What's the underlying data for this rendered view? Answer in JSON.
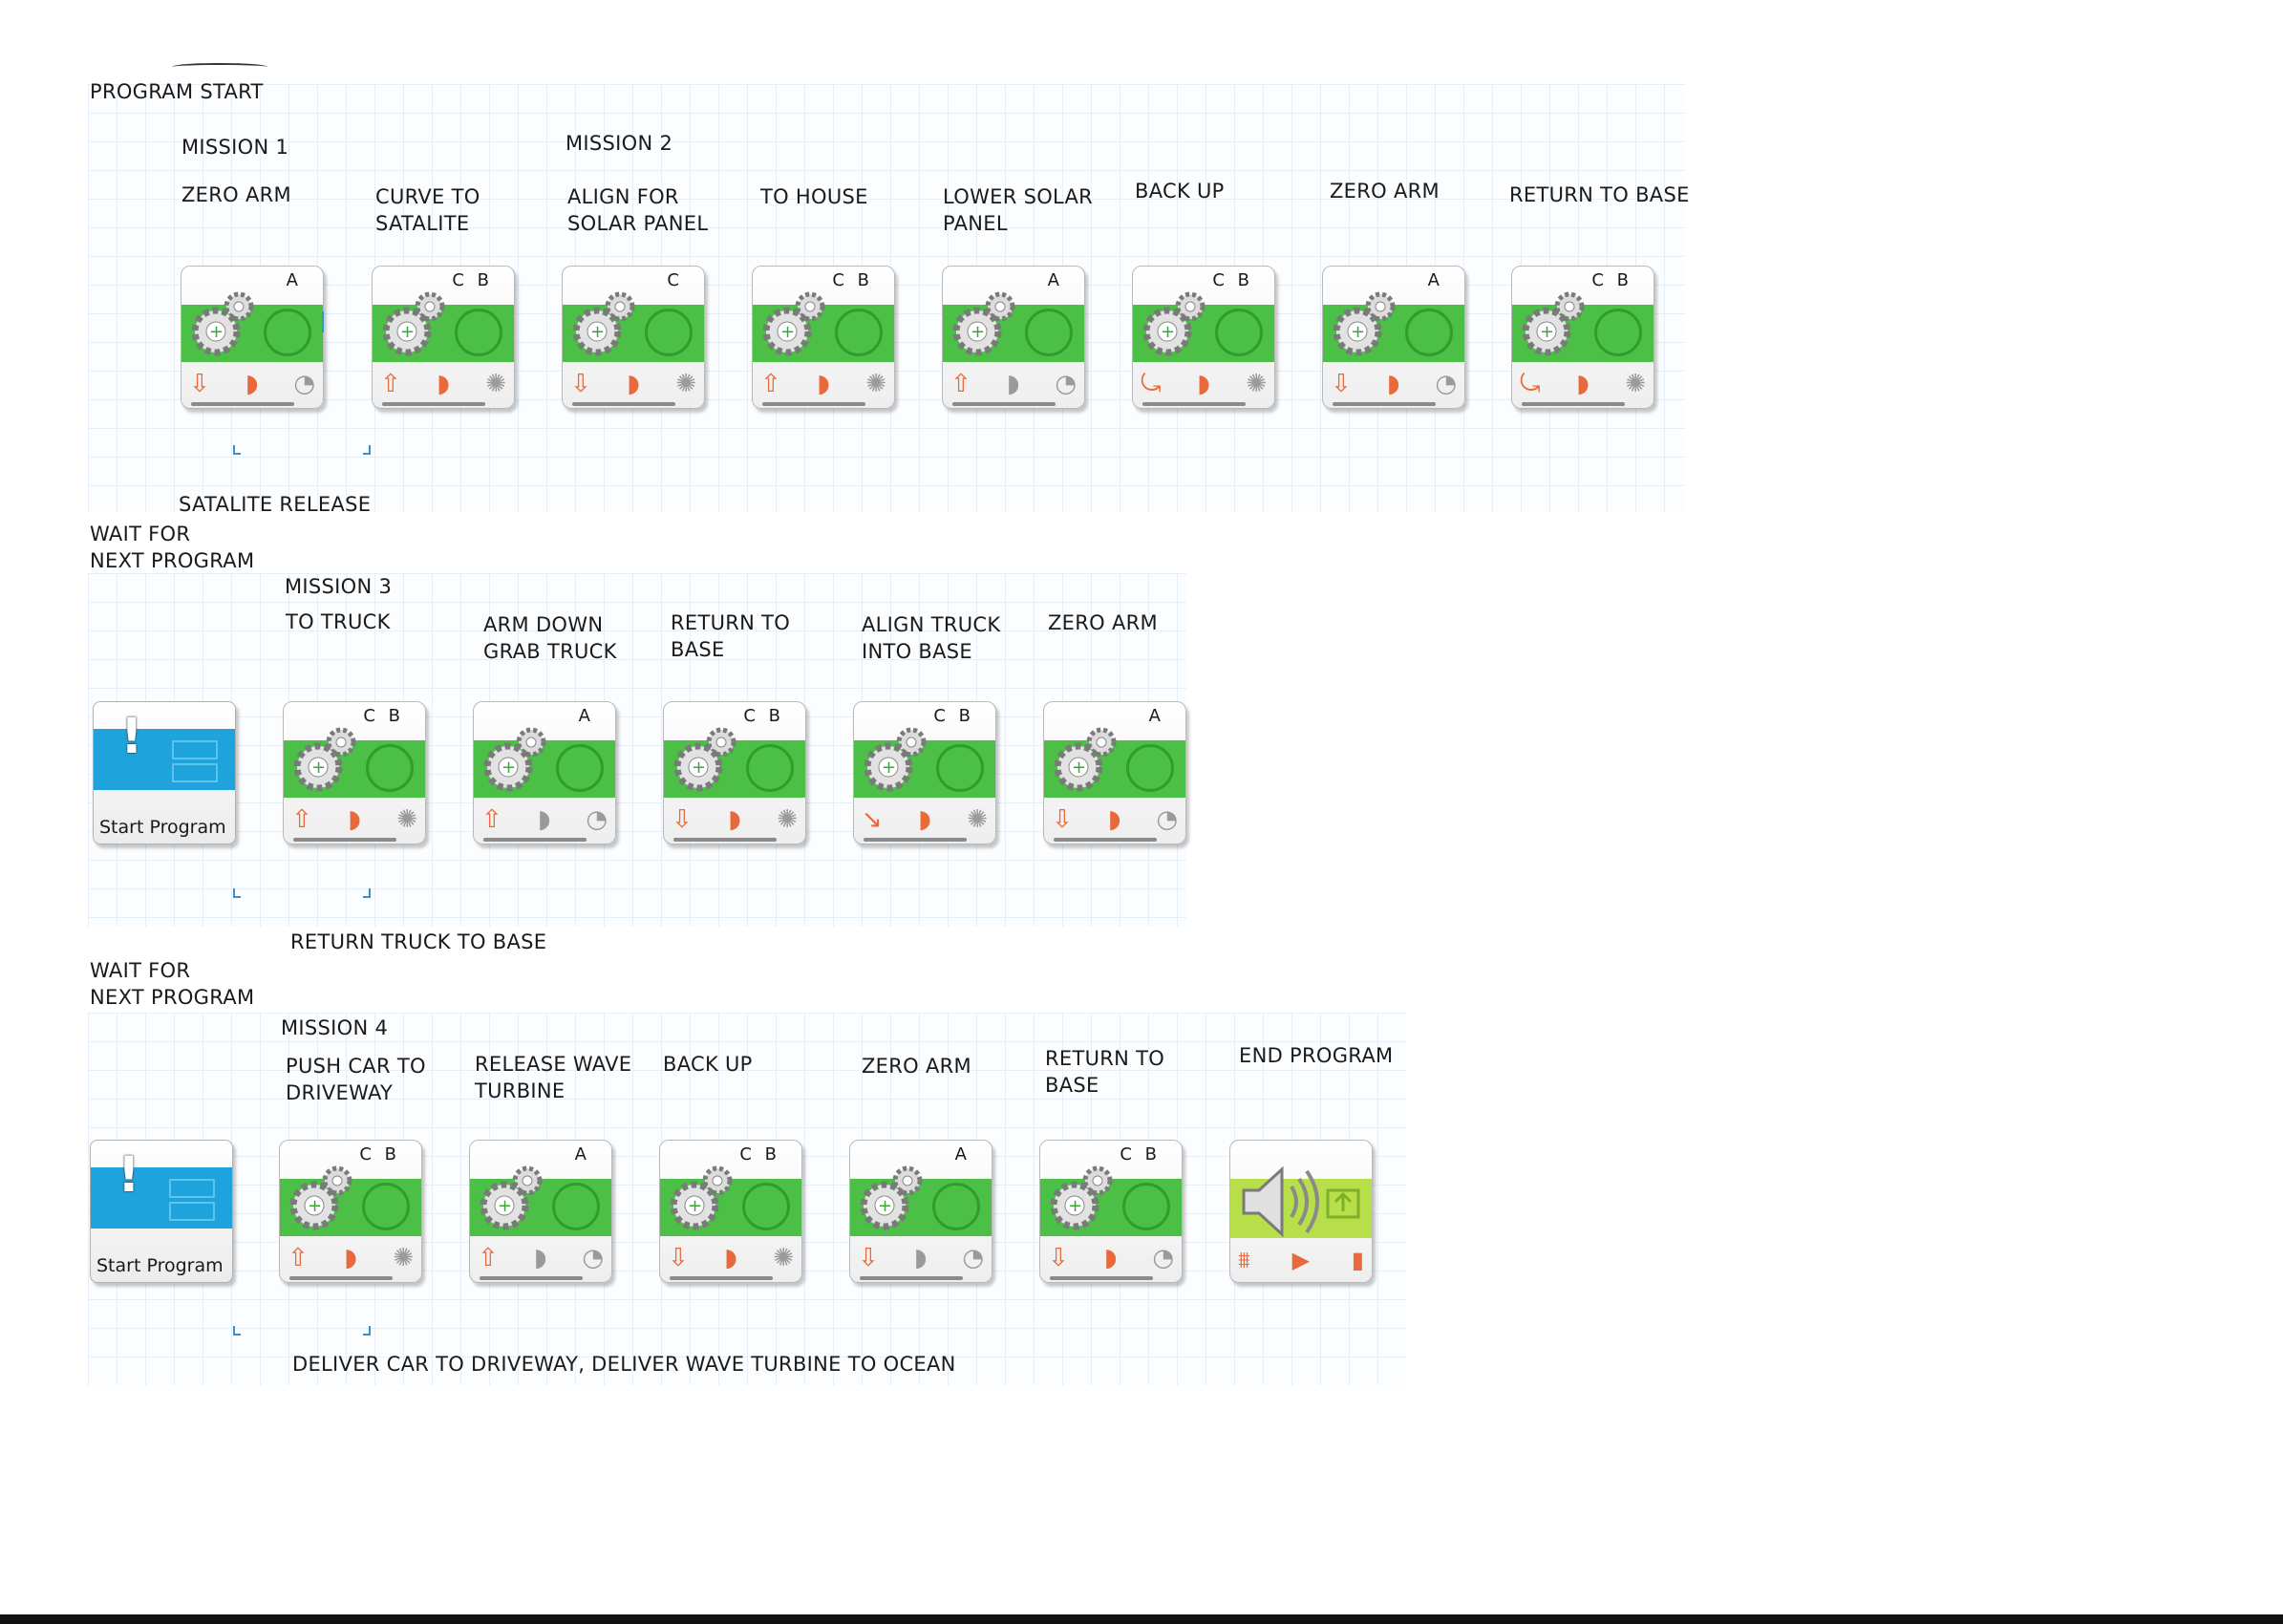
{
  "header": {
    "program_start": "PROGRAM START"
  },
  "row1": {
    "mission1": "MISSION 1",
    "mission2": "MISSION 2",
    "steps": [
      {
        "label": "ZERO ARM",
        "port": "A",
        "dir": "down",
        "power_color": "orange",
        "end": "seconds"
      },
      {
        "label": "CURVE TO\nSATALITE",
        "port": "C B",
        "dir": "up",
        "power_color": "orange",
        "end": "degrees"
      },
      {
        "label": "ALIGN FOR\nSOLAR PANEL",
        "port": "C",
        "dir": "down",
        "power_color": "orange",
        "end": "degrees"
      },
      {
        "label": "TO HOUSE",
        "port": "C B",
        "dir": "up",
        "power_color": "orange",
        "end": "degrees"
      },
      {
        "label": "LOWER SOLAR\nPANEL",
        "port": "A",
        "dir": "up",
        "power_color": "gray",
        "end": "seconds"
      },
      {
        "label": "BACK UP",
        "port": "C B",
        "dir": "steer",
        "power_color": "orange",
        "end": "degrees"
      },
      {
        "label": "ZERO ARM",
        "port": "A",
        "dir": "down",
        "power_color": "orange",
        "end": "seconds"
      },
      {
        "label": "RETURN TO BASE",
        "port": "C B",
        "dir": "steer",
        "power_color": "orange",
        "end": "degrees"
      }
    ],
    "caption": "SATALITE RELEASE"
  },
  "row2": {
    "wait_label": "WAIT FOR\nNEXT PROGRAM",
    "mission": "MISSION 3",
    "start_block_text": "Start Program",
    "steps": [
      {
        "label": "TO TRUCK",
        "port": "C B",
        "dir": "up",
        "power_color": "orange",
        "end": "degrees"
      },
      {
        "label": "ARM DOWN\nGRAB TRUCK",
        "port": "A",
        "dir": "up",
        "power_color": "gray",
        "end": "seconds"
      },
      {
        "label": "RETURN TO\nBASE",
        "port": "C B",
        "dir": "down",
        "power_color": "orange",
        "end": "degrees"
      },
      {
        "label": "ALIGN TRUCK\nINTO BASE",
        "port": "C B",
        "dir": "steer",
        "power_color": "orange",
        "end": "degrees"
      },
      {
        "label": "ZERO ARM",
        "port": "A",
        "dir": "down",
        "power_color": "orange",
        "end": "seconds"
      }
    ],
    "caption": "RETURN TRUCK TO BASE"
  },
  "row3": {
    "wait_label": "WAIT FOR\nNEXT PROGRAM",
    "mission": "MISSION 4",
    "start_block_text": "Start Program",
    "steps": [
      {
        "label": "PUSH CAR TO\nDRIVEWAY",
        "port": "C B",
        "dir": "up",
        "power_color": "orange",
        "end": "degrees"
      },
      {
        "label": "RELEASE WAVE\nTURBINE",
        "port": "A",
        "dir": "up",
        "power_color": "gray",
        "end": "seconds"
      },
      {
        "label": "BACK UP",
        "port": "C B",
        "dir": "down",
        "power_color": "orange",
        "end": "degrees"
      },
      {
        "label": "ZERO ARM",
        "port": "A",
        "dir": "down",
        "power_color": "gray",
        "end": "seconds"
      },
      {
        "label": "RETURN TO\nBASE",
        "port": "C B",
        "dir": "down",
        "power_color": "orange",
        "end": "seconds"
      }
    ],
    "end_label": "END PROGRAM",
    "caption": "DELIVER CAR TO DRIVEWAY, DELIVER WAVE TURBINE TO OCEAN"
  },
  "colors": {
    "motor_band": "#4cc046",
    "start_band": "#1fa3dc",
    "sound_band": "#b7df4a",
    "icon_accent": "#e8693a",
    "connector": "#3a8fd1"
  },
  "icons": {
    "motor": "gears-icon",
    "direction": "arrow-icon",
    "power": "power-dial-icon",
    "duration": "duration-icon",
    "start": "exclamation-icon",
    "sound": "speaker-icon"
  }
}
